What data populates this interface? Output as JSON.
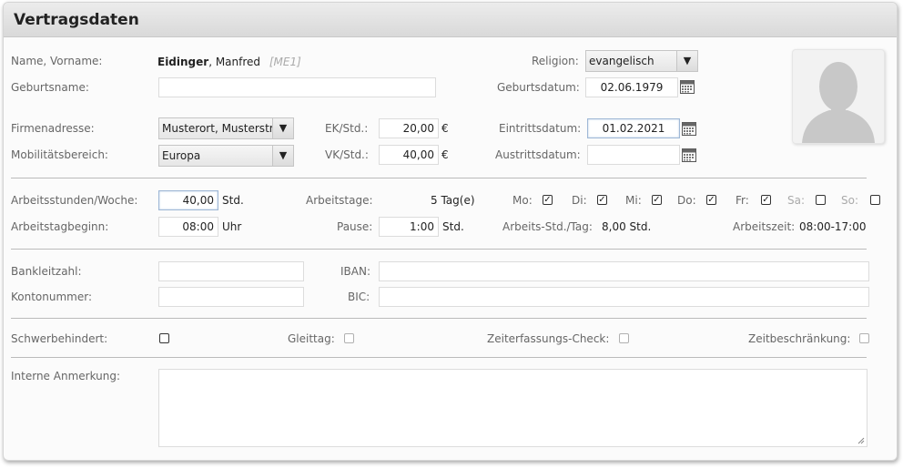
{
  "panel": {
    "title": "Vertragsdaten"
  },
  "person": {
    "name_label": "Name, Vorname:",
    "last_name": "Eidinger",
    "first_name": ", Manfred",
    "code": "[ME1]",
    "birthname_label": "Geburtsname:",
    "birthname_value": "",
    "religion_label": "Religion:",
    "religion_value": "evangelisch",
    "birthdate_label": "Geburtsdatum:",
    "birthdate_value": "02.06.1979"
  },
  "company": {
    "address_label": "Firmenadresse:",
    "address_value": "Musterort, Musterstr",
    "mobility_label": "Mobilitätsbereich:",
    "mobility_value": "Europa",
    "ek_label": "EK/Std.:",
    "ek_value": "20,00",
    "vk_label": "VK/Std.:",
    "vk_value": "40,00",
    "currency": "€",
    "entry_label": "Eintrittsdatum:",
    "entry_value": "01.02.2021",
    "exit_label": "Austrittsdatum:",
    "exit_value": ""
  },
  "work": {
    "hours_week_label": "Arbeitsstunden/Woche:",
    "hours_week_value": "40,00",
    "hours_unit": "Std.",
    "workdays_label": "Arbeitstage:",
    "workdays_value": "5 Tag(e)",
    "days": [
      {
        "label": "Mo:",
        "checked": true,
        "enabled": true
      },
      {
        "label": "Di:",
        "checked": true,
        "enabled": true
      },
      {
        "label": "Mi:",
        "checked": true,
        "enabled": true
      },
      {
        "label": "Do:",
        "checked": true,
        "enabled": true
      },
      {
        "label": "Fr:",
        "checked": true,
        "enabled": true
      },
      {
        "label": "Sa:",
        "checked": false,
        "enabled": false
      },
      {
        "label": "So:",
        "checked": false,
        "enabled": false
      }
    ],
    "start_label": "Arbeitstagbeginn:",
    "start_value": "08:00",
    "start_unit": "Uhr",
    "pause_label": "Pause:",
    "pause_value": "1:00",
    "pause_unit": "Std.",
    "hours_day_label": "Arbeits-Std./Tag:",
    "hours_day_value": "8,00 Std.",
    "worktime_label": "Arbeitszeit:",
    "worktime_value": "08:00-17:00"
  },
  "bank": {
    "blz_label": "Bankleitzahl:",
    "blz_value": "",
    "iban_label": "IBAN:",
    "iban_value": "",
    "account_label": "Kontonummer:",
    "account_value": "",
    "bic_label": "BIC:",
    "bic_value": ""
  },
  "flags": {
    "disabled_label": "Schwerbehindert:",
    "flextime_label": "Gleittag:",
    "timecheck_label": "Zeiterfassungs-Check:",
    "timelimit_label": "Zeitbeschränkung:"
  },
  "notes": {
    "label": "Interne Anmerkung:",
    "value": ""
  },
  "icons": {
    "calendar": "calendar-icon",
    "dropdown": "chevron-down-icon",
    "avatar": "avatar-placeholder-icon",
    "check": "checkmark-icon"
  }
}
